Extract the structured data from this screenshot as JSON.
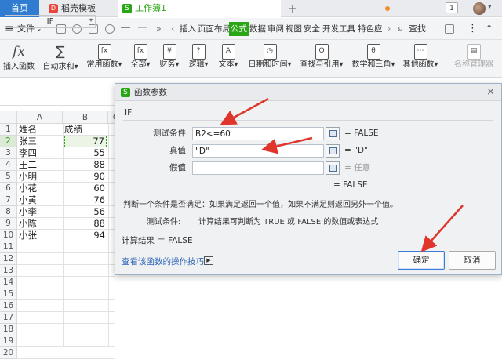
{
  "tabs": {
    "home": "首页",
    "template": "稻壳模板",
    "template_icon": "D",
    "workbook": "工作簿1",
    "workbook_icon": "S",
    "add": "+",
    "badge": "1"
  },
  "menubar": {
    "menu_icon": "≡",
    "file": "文件",
    "file_caret": "⌄",
    "quick_access_more": "»",
    "ribbon_tabs": [
      "插入",
      "页面布局",
      "公式",
      "数据",
      "审阅",
      "视图",
      "安全",
      "开发工具",
      "特色应"
    ],
    "active_tab": "公式",
    "search": "查找",
    "search_icon": "⌕",
    "more": "⋮",
    "collapse": "^"
  },
  "ribbon": {
    "insert_function": {
      "icon": "fx",
      "label": "插入函数"
    },
    "autosum": {
      "icon": "∑",
      "label": "自动求和▾"
    },
    "common": {
      "icon": "fx",
      "label": "常用函数▾"
    },
    "all": {
      "icon": "fx",
      "label": "全部▾"
    },
    "finance": {
      "icon": "¥",
      "label": "财务▾"
    },
    "logic": {
      "icon": "?",
      "label": "逻辑▾"
    },
    "text": {
      "icon": "A",
      "label": "文本▾"
    },
    "datetime": {
      "icon": "◷",
      "label": "日期和时间▾"
    },
    "lookup": {
      "icon": "Q",
      "label": "查找与引用▾"
    },
    "math": {
      "icon": "θ",
      "label": "数学和三角▾"
    },
    "other": {
      "icon": "⋯",
      "label": "其他函数▾"
    },
    "name_manager": {
      "icon": "▤",
      "label": "名称管理器"
    }
  },
  "formula_bar": {
    "namebox": "IF",
    "namebox_caret": "▾"
  },
  "sheet": {
    "columns": [
      "A",
      "B",
      "C"
    ],
    "rows": [
      "1",
      "2",
      "3",
      "4",
      "5",
      "6",
      "7",
      "8",
      "9",
      "10",
      "11",
      "12",
      "13",
      "14",
      "15",
      "16",
      "17",
      "18",
      "19",
      "20"
    ],
    "names": [
      "姓名",
      "张三",
      "李四",
      "王二",
      "小明",
      "小花",
      "小黄",
      "小李",
      "小陈",
      "小张"
    ],
    "scores": [
      "成绩",
      "77",
      "55",
      "88",
      "90",
      "60",
      "76",
      "56",
      "88",
      "94"
    ]
  },
  "dialog": {
    "title_icon": "S",
    "title": "函数参数",
    "close": "×",
    "function_name": "IF",
    "args": [
      {
        "label": "测试条件",
        "value": "B2<=60",
        "result": "= FALSE",
        "hint": false
      },
      {
        "label": "真值",
        "value": "\"D\"",
        "result": "= \"D\"",
        "hint": false
      },
      {
        "label": "假值",
        "value": "",
        "result": "= 任意",
        "hint": true
      }
    ],
    "result_top": "= FALSE",
    "description": "判断一个条件是否满足：如果满足返回一个值，如果不满足则返回另外一个值。",
    "arg_desc_label": "测试条件:",
    "arg_desc_text": "计算结果可判断为 TRUE 或 FALSE 的数值或表达式",
    "calc_result": "计算结果 ＝ FALSE",
    "help_link": "查看该函数的操作技巧",
    "help_icon": "▶",
    "ok": "确定",
    "cancel": "取消"
  },
  "colors": {
    "accent_green": "#2aa515",
    "home_tab": "#2f7cd1",
    "arrow_red": "#e0352a",
    "link_blue": "#2a63b7"
  }
}
